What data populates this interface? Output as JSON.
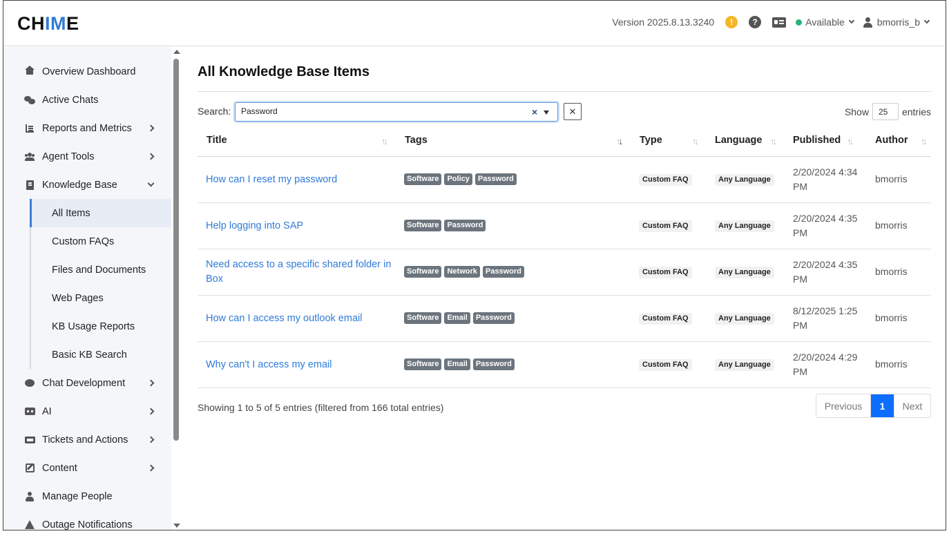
{
  "header": {
    "logo_prefix": "CH",
    "logo_accent": "IM",
    "logo_suffix": "E",
    "version": "Version 2025.8.13.3240",
    "status": "Available",
    "username": "bmorris_b",
    "colors": {
      "accent": "#2f7bd8",
      "status_dot": "#27b377",
      "warning": "#f5b62a"
    }
  },
  "sidebar": {
    "items": [
      {
        "label": "Overview Dashboard",
        "icon": "home-icon"
      },
      {
        "label": "Active Chats",
        "icon": "chat-icon"
      },
      {
        "label": "Reports and Metrics",
        "icon": "bar-chart-icon"
      },
      {
        "label": "Agent Tools",
        "icon": "users-icon"
      },
      {
        "label": "Knowledge Base",
        "icon": "book-icon"
      },
      {
        "label": "Chat Development",
        "icon": "comment-icon"
      },
      {
        "label": "AI",
        "icon": "robot-icon"
      },
      {
        "label": "Tickets and Actions",
        "icon": "ticket-icon"
      },
      {
        "label": "Content",
        "icon": "edit-icon"
      },
      {
        "label": "Manage People",
        "icon": "person-icon"
      },
      {
        "label": "Outage Notifications",
        "icon": "warning-icon"
      }
    ],
    "kb_sub_items": [
      {
        "label": "All Items",
        "active": true
      },
      {
        "label": "Custom FAQs"
      },
      {
        "label": "Files and Documents"
      },
      {
        "label": "Web Pages"
      },
      {
        "label": "KB Usage Reports"
      },
      {
        "label": "Basic KB Search"
      }
    ]
  },
  "main": {
    "title": "All Knowledge Base Items",
    "search_label": "Search:",
    "search_value": "Password",
    "show_label": "Show",
    "show_value": "25",
    "entries_label": "entries",
    "columns": [
      "Title",
      "Tags",
      "Type",
      "Language",
      "Published",
      "Author"
    ],
    "rows": [
      {
        "title": "How can I reset my password",
        "tags": [
          "Software",
          "Policy",
          "Password"
        ],
        "type": "Custom FAQ",
        "language": "Any Language",
        "published": "2/20/2024 4:34 PM",
        "author": "bmorris"
      },
      {
        "title": "Help logging into SAP",
        "tags": [
          "Software",
          "Password"
        ],
        "type": "Custom FAQ",
        "language": "Any Language",
        "published": "2/20/2024 4:35 PM",
        "author": "bmorris"
      },
      {
        "title": "Need access to a specific shared folder in Box",
        "tags": [
          "Software",
          "Network",
          "Password"
        ],
        "type": "Custom FAQ",
        "language": "Any Language",
        "published": "2/20/2024 4:35 PM",
        "author": "bmorris"
      },
      {
        "title": "How can I access my outlook email",
        "tags": [
          "Software",
          "Email",
          "Password"
        ],
        "type": "Custom FAQ",
        "language": "Any Language",
        "published": "8/12/2025 1:25 PM",
        "author": "bmorris"
      },
      {
        "title": "Why can't I access my email",
        "tags": [
          "Software",
          "Email",
          "Password"
        ],
        "type": "Custom FAQ",
        "language": "Any Language",
        "published": "2/20/2024 4:29 PM",
        "author": "bmorris"
      }
    ],
    "info": "Showing 1 to 5 of 5 entries (filtered from 166 total entries)",
    "pagination": {
      "previous": "Previous",
      "current": "1",
      "next": "Next"
    }
  }
}
